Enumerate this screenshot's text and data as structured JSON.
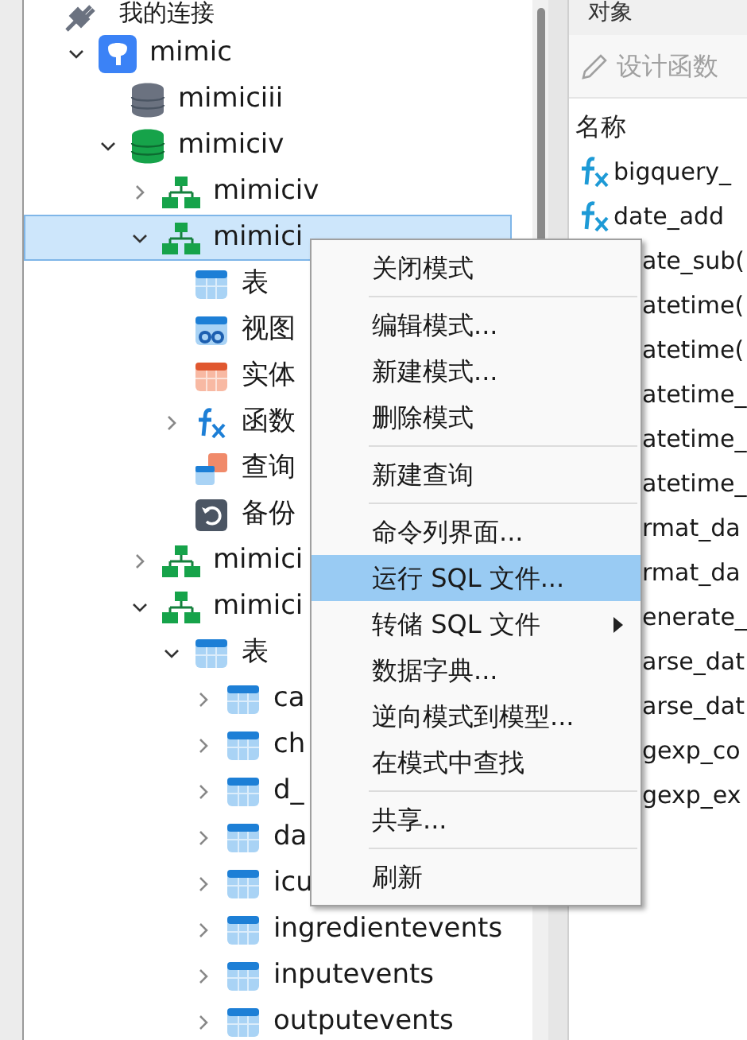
{
  "tree": {
    "label": "我的连接",
    "kind": "group",
    "children": [
      {
        "label": "mimic",
        "kind": "server",
        "expanded": true,
        "selected": false,
        "children": [
          {
            "label": "mimiciii",
            "kind": "database",
            "open": false,
            "selected": false
          },
          {
            "label": "mimiciv",
            "kind": "database",
            "open": true,
            "expanded": true,
            "selected": false,
            "children": [
              {
                "label": "mimiciv",
                "kind": "schema",
                "expanded": false,
                "selected": false
              },
              {
                "label": "mimici",
                "kind": "schema",
                "expanded": true,
                "selected": true,
                "children": [
                  {
                    "label": "表",
                    "kind": "tables",
                    "selected": false
                  },
                  {
                    "label": "视图",
                    "kind": "views",
                    "selected": false
                  },
                  {
                    "label": "实体",
                    "kind": "entities",
                    "selected": false
                  },
                  {
                    "label": "函数",
                    "kind": "functions",
                    "expanded": false,
                    "selected": false
                  },
                  {
                    "label": "查询",
                    "kind": "queries",
                    "selected": false
                  },
                  {
                    "label": "备份",
                    "kind": "backups",
                    "selected": false
                  }
                ]
              },
              {
                "label": "mimici",
                "kind": "schema",
                "expanded": false,
                "selected": false
              },
              {
                "label": "mimici",
                "kind": "schema",
                "expanded": true,
                "selected": false,
                "children": [
                  {
                    "label": "表",
                    "kind": "tables",
                    "expanded": true,
                    "selected": false,
                    "children": [
                      {
                        "label": "ca",
                        "kind": "table",
                        "expanded": false,
                        "selected": false
                      },
                      {
                        "label": "ch",
                        "kind": "table",
                        "expanded": false,
                        "selected": false
                      },
                      {
                        "label": "d_",
                        "kind": "table",
                        "expanded": false,
                        "selected": false
                      },
                      {
                        "label": "da",
                        "kind": "table",
                        "expanded": false,
                        "selected": false
                      },
                      {
                        "label": "icu",
                        "kind": "table",
                        "expanded": false,
                        "selected": false
                      },
                      {
                        "label": "ingredientevents",
                        "kind": "table",
                        "expanded": false,
                        "selected": false
                      },
                      {
                        "label": "inputevents",
                        "kind": "table",
                        "expanded": false,
                        "selected": false
                      },
                      {
                        "label": "outputevents",
                        "kind": "table",
                        "expanded": false,
                        "selected": false
                      }
                    ]
                  }
                ]
              }
            ]
          }
        ]
      }
    ]
  },
  "right_panel": {
    "tab": "对象",
    "toolbar_button": {
      "label": "设计函数",
      "disabled": true
    },
    "column_header": "名称",
    "rows": [
      {
        "kind": "function",
        "label": "bigquery_"
      },
      {
        "kind": "function",
        "label": "date_add"
      },
      {
        "kind": "fragment",
        "label": "ate_sub("
      },
      {
        "kind": "fragment",
        "label": "atetime("
      },
      {
        "kind": "fragment",
        "label": "atetime("
      },
      {
        "kind": "fragment",
        "label": "atetime_"
      },
      {
        "kind": "fragment",
        "label": "atetime_"
      },
      {
        "kind": "fragment",
        "label": "atetime_"
      },
      {
        "kind": "fragment",
        "label": "rmat_da"
      },
      {
        "kind": "fragment",
        "label": "rmat_da"
      },
      {
        "kind": "fragment",
        "label": "enerate_"
      },
      {
        "kind": "fragment",
        "label": "arse_dat"
      },
      {
        "kind": "fragment",
        "label": "arse_dat"
      },
      {
        "kind": "fragment",
        "label": "gexp_co"
      },
      {
        "kind": "fragment",
        "label": "gexp_ex"
      }
    ]
  },
  "context_menu": [
    {
      "kind": "item",
      "label": "关闭模式",
      "selected": false,
      "has_submenu": false
    },
    {
      "kind": "separator"
    },
    {
      "kind": "item",
      "label": "编辑模式...",
      "selected": false,
      "has_submenu": false
    },
    {
      "kind": "item",
      "label": "新建模式...",
      "selected": false,
      "has_submenu": false
    },
    {
      "kind": "item",
      "label": "删除模式",
      "selected": false,
      "has_submenu": false
    },
    {
      "kind": "separator"
    },
    {
      "kind": "item",
      "label": "新建查询",
      "selected": false,
      "has_submenu": false
    },
    {
      "kind": "separator"
    },
    {
      "kind": "item",
      "label": "命令列界面...",
      "selected": false,
      "has_submenu": false
    },
    {
      "kind": "item",
      "label": "运行 SQL 文件...",
      "selected": true,
      "has_submenu": false
    },
    {
      "kind": "item",
      "label": "转储 SQL 文件",
      "selected": false,
      "has_submenu": true
    },
    {
      "kind": "item",
      "label": "数据字典...",
      "selected": false,
      "has_submenu": false
    },
    {
      "kind": "item",
      "label": "逆向模式到模型...",
      "selected": false,
      "has_submenu": false
    },
    {
      "kind": "item",
      "label": "在模式中查找",
      "selected": false,
      "has_submenu": false
    },
    {
      "kind": "separator"
    },
    {
      "kind": "item",
      "label": "共享...",
      "selected": false,
      "has_submenu": false
    },
    {
      "kind": "separator"
    },
    {
      "kind": "item",
      "label": "刷新",
      "selected": false,
      "has_submenu": false
    }
  ]
}
